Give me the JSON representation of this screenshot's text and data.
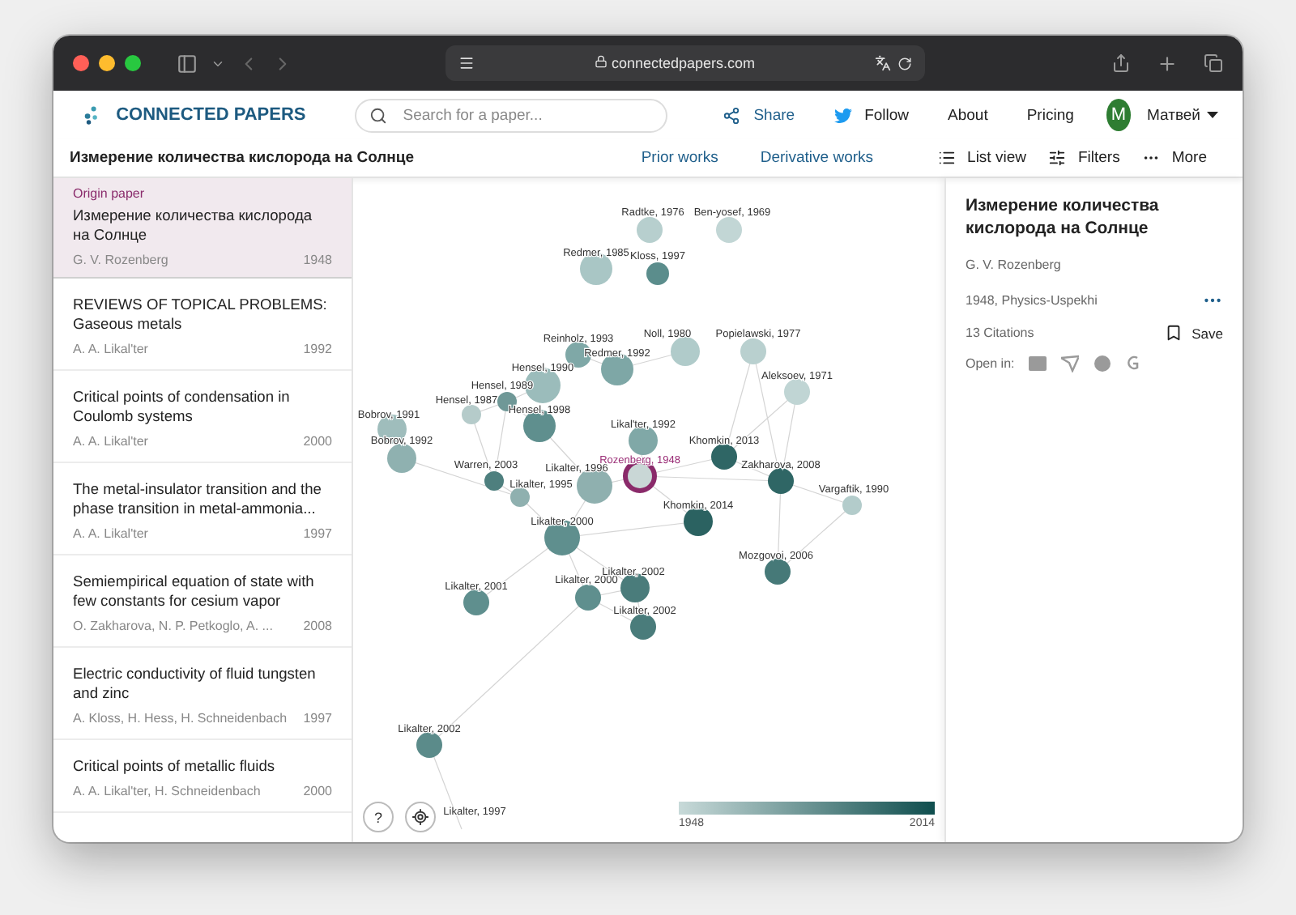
{
  "browser": {
    "url": "connectedpapers.com"
  },
  "nav": {
    "logo": "CONNECTED PAPERS",
    "search": {
      "placeholder": "Search for a paper..."
    },
    "links": [
      {
        "kind": "share",
        "label": "Share"
      },
      {
        "kind": "follow",
        "label": "Follow"
      },
      {
        "kind": "plain",
        "label": "About"
      },
      {
        "kind": "plain",
        "label": "Pricing"
      }
    ],
    "user": {
      "initial": "M",
      "name": "Матвей"
    }
  },
  "subheader": {
    "title": "Измерение количества кислорода на Солнце",
    "tabs": [
      {
        "label": "Prior works"
      },
      {
        "label": "Derivative works"
      }
    ],
    "tools": [
      {
        "kind": "list",
        "label": "List view"
      },
      {
        "kind": "filters",
        "label": "Filters"
      },
      {
        "kind": "more",
        "label": "More"
      }
    ]
  },
  "papers": [
    {
      "tag": "Origin paper",
      "title": "Измерение количества кислорода на Солнце",
      "authors": "G. V. Rozenberg",
      "year": "1948",
      "selected": true
    },
    {
      "title": "REVIEWS OF TOPICAL PROBLEMS: Gaseous metals",
      "authors": "A. A. Likal'ter",
      "year": "1992",
      "selected": false
    },
    {
      "title": "Critical points of condensation in Coulomb systems",
      "authors": "A. A. Likal'ter",
      "year": "2000",
      "selected": false
    },
    {
      "title": "The metal-insulator transition and the phase transition in metal-ammonia...",
      "authors": "A. A. Likal'ter",
      "year": "1997",
      "selected": false
    },
    {
      "title": "Semiempirical equation of state with few constants for cesium vapor",
      "authors": "O. Zakharova, N. P. Petkoglo, A. ...",
      "year": "2008",
      "selected": false
    },
    {
      "title": "Electric conductivity of fluid tungsten and zinc",
      "authors": "A. Kloss, H. Hess, H. Schneidenbach",
      "year": "1997",
      "selected": false
    },
    {
      "title": "Critical points of metallic fluids",
      "authors": "A. A. Likal'ter, H. Schneidenbach",
      "year": "2000",
      "selected": false
    }
  ],
  "graph": {
    "nodes": [
      {
        "label": "Radtke, 1976",
        "color": "#b7cfce"
      },
      {
        "label": "Ben-yosef, 1969",
        "color": "#c2d6d5"
      },
      {
        "label": "Redmer, 1985",
        "color": "#a9c6c5"
      },
      {
        "label": "Kloss, 1997",
        "color": "#5b8d8c"
      },
      {
        "label": "Reinholz, 1993",
        "color": "#7fa8a7"
      },
      {
        "label": "Redmer, 1992",
        "color": "#7ea7a6"
      },
      {
        "label": "Noll, 1980",
        "color": "#b0cbca"
      },
      {
        "label": "Popielawski, 1977",
        "color": "#b9d0cf"
      },
      {
        "label": "Hensel, 1990",
        "color": "#9bbcbb"
      },
      {
        "label": "Hensel, 1989",
        "color": "#6f9897"
      },
      {
        "label": "Hensel, 1987",
        "color": "#b5cbca"
      },
      {
        "label": "Hensel, 1998",
        "color": "#5f8f8e"
      },
      {
        "label": "Bobrov, 1991",
        "color": "#9fbdbc"
      },
      {
        "label": "Bobrov, 1992",
        "color": "#8fb1b0"
      },
      {
        "label": "Aleksoev, 1971",
        "color": "#c0d5d4"
      },
      {
        "label": "Likal'ter, 1992",
        "color": "#80a8a7"
      },
      {
        "label": "Warren, 2003",
        "color": "#4e7f7e"
      },
      {
        "label": "Likalter, 1996",
        "color": "#8fb0af"
      },
      {
        "label": "Likalter, 1995",
        "color": "#8fb0af"
      },
      {
        "label": "Khomkin, 2013",
        "color": "#2f6665"
      },
      {
        "label": "Zakharova, 2008",
        "color": "#2f6665"
      },
      {
        "label": "Vargaftik, 1990",
        "color": "#b3cccb"
      },
      {
        "label": "Khomkin, 2014",
        "color": "#2b6261"
      },
      {
        "label": "Likalter, 2000",
        "color": "#5f8f8e"
      },
      {
        "label": "Mozgovoi, 2006",
        "color": "#467978"
      },
      {
        "label": "Likalter, 2001",
        "color": "#5f8f8e"
      },
      {
        "label": "Likalter, 2000",
        "color": "#5f8f8e"
      },
      {
        "label": "Likalter, 2002",
        "color": "#4a7c7b"
      },
      {
        "label": "Likalter, 2002",
        "color": "#4a7c7b"
      },
      {
        "label": "Likalter, 2002",
        "color": "#5b8b8a"
      },
      {
        "label": "Likalter, 1997",
        "kind": "offscreen"
      },
      {
        "label": "Rozenberg, 1948",
        "kind": "origin",
        "color": "#c9d7d6"
      }
    ],
    "legend": {
      "from": "1948",
      "to": "2014"
    },
    "buttons": [
      {
        "kind": "help",
        "label": "?"
      },
      {
        "kind": "locate"
      }
    ]
  },
  "details": {
    "title": "Измерение количества кислорода на Солнце",
    "authors": "G. V. Rozenberg",
    "meta": "1948, Physics-Uspekhi",
    "citations": "13 Citations",
    "save": "Save",
    "open_in": "Open in:"
  }
}
